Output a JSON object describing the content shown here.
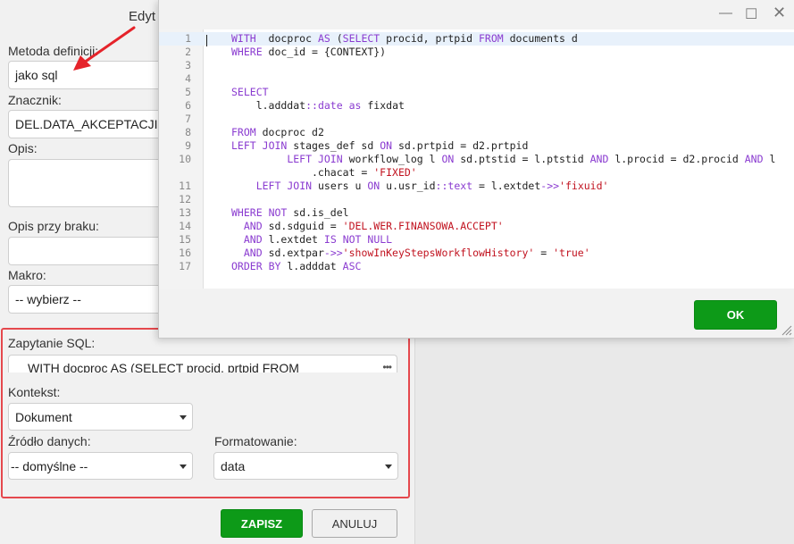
{
  "form": {
    "title": "Edyt",
    "method_label": "Metoda definicji:",
    "method_value": "jako sql",
    "tag_label": "Znacznik:",
    "tag_value": "DEL.DATA_AKCEPTACJI",
    "desc_label": "Opis:",
    "desc_value": "",
    "missing_desc_label": "Opis przy braku:",
    "missing_desc_value": "",
    "macro_label": "Makro:",
    "macro_value": "-- wybierz --",
    "sql_label": "Zapytanie SQL:",
    "sql_value": "WITH  docproc AS (SELECT procid, prtpid FROM",
    "sql_more_icon": "ellipsis-icon",
    "context_label": "Kontekst:",
    "context_value": "Dokument",
    "source_label": "Źródło danych:",
    "source_value": "-- domyślne --",
    "format_label": "Formatowanie:",
    "format_value": "data",
    "save_label": "ZAPISZ",
    "cancel_label": "ANULUJ"
  },
  "modal": {
    "minimize_icon": "minimize-icon",
    "maximize_icon": "maximize-icon",
    "close_icon": "close-icon",
    "ok_label": "OK",
    "active_line": 1,
    "lines": [
      {
        "n": "1",
        "text": "WITH  docproc AS (SELECT procid, prtpid FROM documents d"
      },
      {
        "n": "2",
        "text": "WHERE doc_id = {CONTEXT})"
      },
      {
        "n": "3",
        "text": ""
      },
      {
        "n": "4",
        "text": ""
      },
      {
        "n": "5",
        "text": "SELECT"
      },
      {
        "n": "6",
        "text": "    l.adddat::date as fixdat"
      },
      {
        "n": "7",
        "text": ""
      },
      {
        "n": "8",
        "text": "FROM docproc d2"
      },
      {
        "n": "9",
        "text": "LEFT JOIN stages_def sd ON sd.prtpid = d2.prtpid"
      },
      {
        "n": "10",
        "text": "         LEFT JOIN workflow_log l ON sd.ptstid = l.ptstid AND l.procid = d2.procid AND l"
      },
      {
        "n": "",
        "text": "             .chacat = 'FIXED'"
      },
      {
        "n": "11",
        "text": "    LEFT JOIN users u ON u.usr_id::text = l.extdet->>'fixuid'"
      },
      {
        "n": "12",
        "text": ""
      },
      {
        "n": "13",
        "text": "WHERE NOT sd.is_del"
      },
      {
        "n": "14",
        "text": "  AND sd.sdguid = 'DEL.WER.FINANSOWA.ACCEPT'"
      },
      {
        "n": "15",
        "text": "  AND l.extdet IS NOT NULL"
      },
      {
        "n": "16",
        "text": "  AND sd.extpar->>'showInKeyStepsWorkflowHistory' = 'true'"
      },
      {
        "n": "17",
        "text": "ORDER BY l.adddat ASC"
      }
    ]
  },
  "colors": {
    "keyword": "#8a3bd0",
    "string": "#c1121f",
    "accent_green": "#0d9a18",
    "highlight_red": "#e5484d"
  }
}
